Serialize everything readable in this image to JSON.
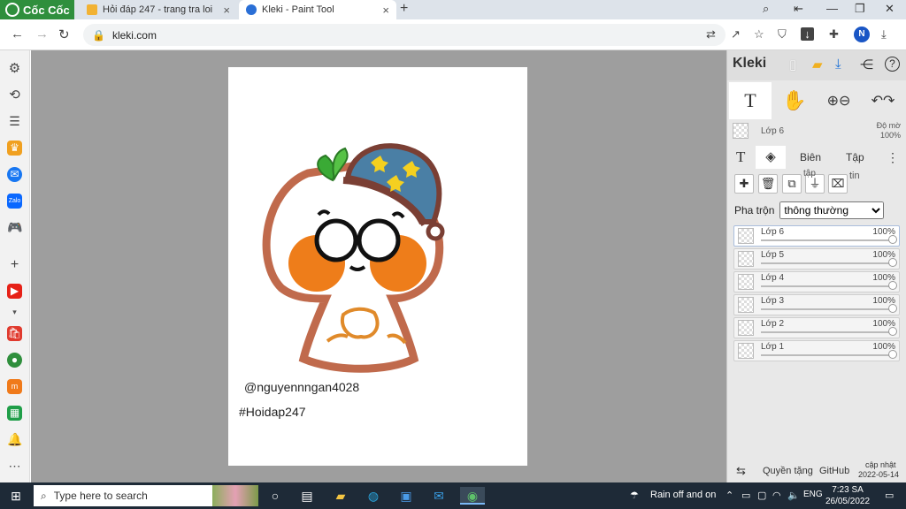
{
  "browser": {
    "brand": "Cốc Cốc",
    "tabs": [
      {
        "title": "Hỏi đáp 247 - trang tra loi",
        "active": false
      },
      {
        "title": "Kleki - Paint Tool",
        "active": true
      }
    ],
    "url": "kleki.com",
    "profile_initial": "N"
  },
  "canvas": {
    "signature_line1": "@nguyennngan4028",
    "signature_line2": "#Hoidap247"
  },
  "kleki": {
    "logo": "Kleki",
    "layer_header": {
      "name": "Lớp 6",
      "opacity_label": "Độ mờ",
      "opacity_value": "100%"
    },
    "tabs": [
      "Biên",
      "Tập",
      "tin"
    ],
    "tab_extra": "tập",
    "blend_label": "Pha trộn",
    "blend_value": "thông thường",
    "layers": [
      {
        "name": "Lớp 6",
        "opacity": "100%",
        "active": true
      },
      {
        "name": "Lớp 5",
        "opacity": "100%",
        "active": false
      },
      {
        "name": "Lớp 4",
        "opacity": "100%",
        "active": false
      },
      {
        "name": "Lớp 3",
        "opacity": "100%",
        "active": false
      },
      {
        "name": "Lớp 2",
        "opacity": "100%",
        "active": false
      },
      {
        "name": "Lớp 1",
        "opacity": "100%",
        "active": false
      }
    ],
    "footer": {
      "rights": "Quyền tặng",
      "github": "GitHub",
      "update_label": "cập nhật",
      "update_date": "2022-05-14"
    }
  },
  "taskbar": {
    "search_placeholder": "Type here to search",
    "weather": "Rain off and on",
    "lang": "ENG",
    "time": "7:23 SA",
    "date": "26/05/2022"
  }
}
